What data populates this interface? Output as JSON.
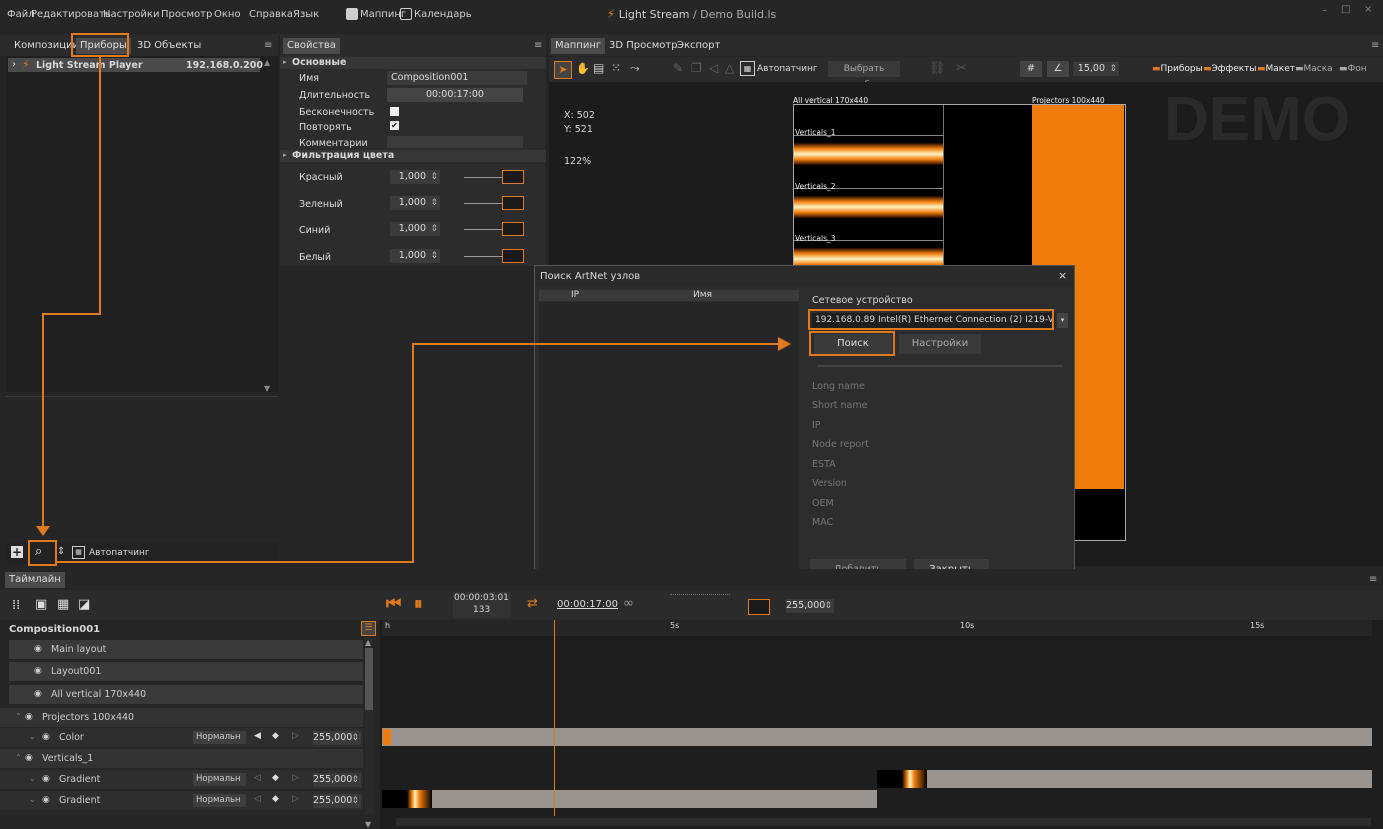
{
  "menu": {
    "items": [
      "Файл",
      "Редактировать",
      "Настройки",
      "Просмотр",
      "Окно",
      "Справка",
      "Язык"
    ],
    "mapping_checkbox": "Маппинг",
    "calendar_checkbox": "Календарь",
    "app_name": "Light Stream",
    "doc_title": " / Demo Build.ls"
  },
  "left_panel": {
    "tabs": [
      "Композиции",
      "Приборы",
      "3D Объекты"
    ],
    "active_tab": "Приборы",
    "device_name": "Light Stream Player",
    "device_ip": "192.168.0.200",
    "autopatch_label": "Автопатчинг"
  },
  "properties": {
    "tab": "Свойства",
    "section_main": "Основные",
    "rows": [
      {
        "label": "Имя",
        "value": "Composition001"
      },
      {
        "label": "Длительность",
        "value": "00:00:17:00"
      },
      {
        "label": "Бесконечность",
        "value": ""
      },
      {
        "label": "Повторять",
        "value": "✔"
      },
      {
        "label": "Комментарии",
        "value": ""
      }
    ],
    "section_filter": "Фильтрация цвета",
    "filters": [
      {
        "label": "Красный",
        "value": "1,000"
      },
      {
        "label": "Зеленый",
        "value": "1,000"
      },
      {
        "label": "Синий",
        "value": "1,000"
      },
      {
        "label": "Белый",
        "value": "1,000"
      }
    ]
  },
  "mapping": {
    "tabs": [
      "Маппинг",
      "3D Просмотр",
      "Экспорт"
    ],
    "autopatch_label": "Автопатчинг",
    "choose_device": "Выбрать прибор",
    "zoom_value": "15,00",
    "filters": [
      "Приборы",
      "Эффекты",
      "Макет",
      "Маска",
      "Фон"
    ],
    "coord_x": "X: 502",
    "coord_y": "Y: 521",
    "zoom_pct": "122%",
    "demo_watermark": "DEMO",
    "layout_title": "All vertical 170x440",
    "projectors_title": "Projectors 100x440",
    "verticals": [
      "Verticals_1",
      "Verticals_2",
      "Verticals_3"
    ]
  },
  "dialog": {
    "title": "Поиск ArtNet узлов",
    "col_ip": "IP",
    "col_name": "Имя",
    "network_label": "Сетевое устройство",
    "network_value": "192.168.0.89 Intel(R) Ethernet Connection (2) I219-V",
    "search_button": "Поиск",
    "settings_button": "Настройки",
    "fields": [
      "Long name",
      "Short name",
      "IP",
      "Node report",
      "ESTA",
      "Version",
      "OEM",
      "MAC"
    ],
    "add_selected": "Добавить выбранные",
    "close_button": "Закрыть"
  },
  "timeline": {
    "tab": "Таймлайн",
    "time_top": "00:00:03:01",
    "frame": "133",
    "duration": "00:00:17:00",
    "master_value": "255,000",
    "ruler_labels": [
      "h",
      "5s",
      "10s",
      "15s"
    ],
    "composition": "Composition001",
    "rows": [
      {
        "name": "Main layout"
      },
      {
        "name": "Layout001"
      },
      {
        "name": "All vertical 170x440"
      },
      {
        "name": "Projectors 100x440"
      },
      {
        "name": "Color",
        "blend": "Нормальн",
        "value": "255,000"
      },
      {
        "name": "Verticals_1"
      },
      {
        "name": "Gradient",
        "blend": "Нормальн",
        "value": "255,000"
      },
      {
        "name": "Gradient",
        "blend": "Нормальн",
        "value": "255,000"
      }
    ]
  },
  "colors": {
    "accent": "#e07a1a",
    "panel_bg": "#262626",
    "toolbar_bg": "#2b2b2b"
  }
}
